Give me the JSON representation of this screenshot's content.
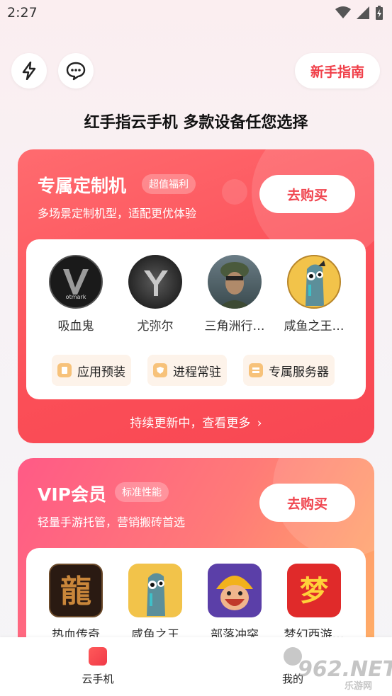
{
  "status_bar": {
    "time": "2:27"
  },
  "header": {
    "guide_label": "新手指南",
    "headline": "红手指云手机 多款设备任您选择"
  },
  "cards": [
    {
      "title": "专属定制机",
      "tag": "超值福利",
      "subtitle": "多场景定制机型，适配更优体验",
      "buy_label": "去购买",
      "games": [
        {
          "name": "吸血鬼",
          "icon": "vampire-game-icon",
          "logo_text": "V",
          "logo_sub": "otmark"
        },
        {
          "name": "尤弥尔",
          "icon": "ymir-game-icon",
          "logo_text": "Y"
        },
        {
          "name": "三角洲行…",
          "icon": "delta-force-game-icon"
        },
        {
          "name": "咸鱼之王…",
          "icon": "salted-fish-game-icon"
        }
      ],
      "features": [
        "应用预装",
        "进程常驻",
        "专属服务器"
      ],
      "more_label": "持续更新中，查看更多"
    },
    {
      "title": "VIP会员",
      "tag": "标准性能",
      "subtitle": "轻量手游托管，营销搬砖首选",
      "buy_label": "去购买",
      "games": [
        {
          "name": "热血传奇",
          "icon": "legend-game-icon",
          "logo_text": "龍"
        },
        {
          "name": "咸鱼之王",
          "icon": "salted-fish-game-icon"
        },
        {
          "name": "部落冲突",
          "icon": "clash-of-clans-game-icon"
        },
        {
          "name": "梦幻西游…",
          "icon": "fantasy-westward-game-icon",
          "logo_text": "梦"
        }
      ]
    }
  ],
  "tabbar": {
    "tabs": [
      {
        "label": "云手机",
        "icon": "cloud-phone-icon",
        "active": true
      },
      {
        "label": "我的",
        "icon": "profile-icon",
        "active": false
      }
    ]
  },
  "watermark": {
    "main": "962.NET",
    "sub": "乐游网"
  },
  "colors": {
    "accent": "#f0404a",
    "card1": "#fb4e57",
    "card2_start": "#ff5a86",
    "card2_end": "#ffb165"
  }
}
